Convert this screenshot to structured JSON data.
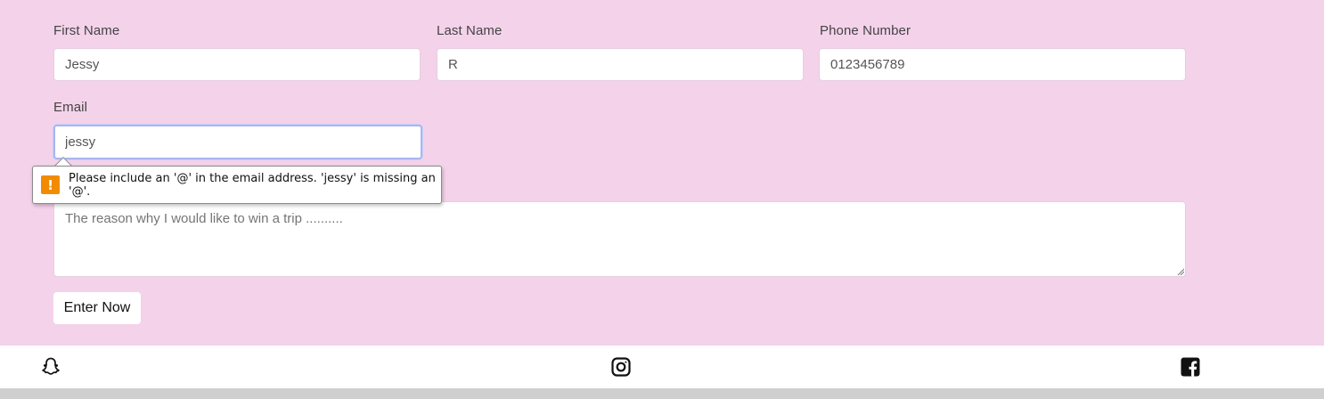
{
  "form": {
    "first_name": {
      "label": "First Name",
      "value": "Jessy"
    },
    "last_name": {
      "label": "Last Name",
      "value": "R"
    },
    "phone": {
      "label": "Phone Number",
      "value": "0123456789"
    },
    "email": {
      "label": "Email",
      "value": "jessy"
    },
    "message": {
      "placeholder": "The reason why I would like to win a trip .........."
    },
    "submit_label": "Enter Now"
  },
  "validation_tooltip": {
    "icon": "warning-icon",
    "message": "Please include an '@' in the email address. 'jessy' is missing an '@'."
  },
  "footer": {
    "icons": [
      "snapchat-icon",
      "instagram-icon",
      "facebook-icon"
    ]
  },
  "colors": {
    "form_background": "#f4d2ea",
    "warning": "#f28b00",
    "focus_ring": "#a9b6f0"
  }
}
